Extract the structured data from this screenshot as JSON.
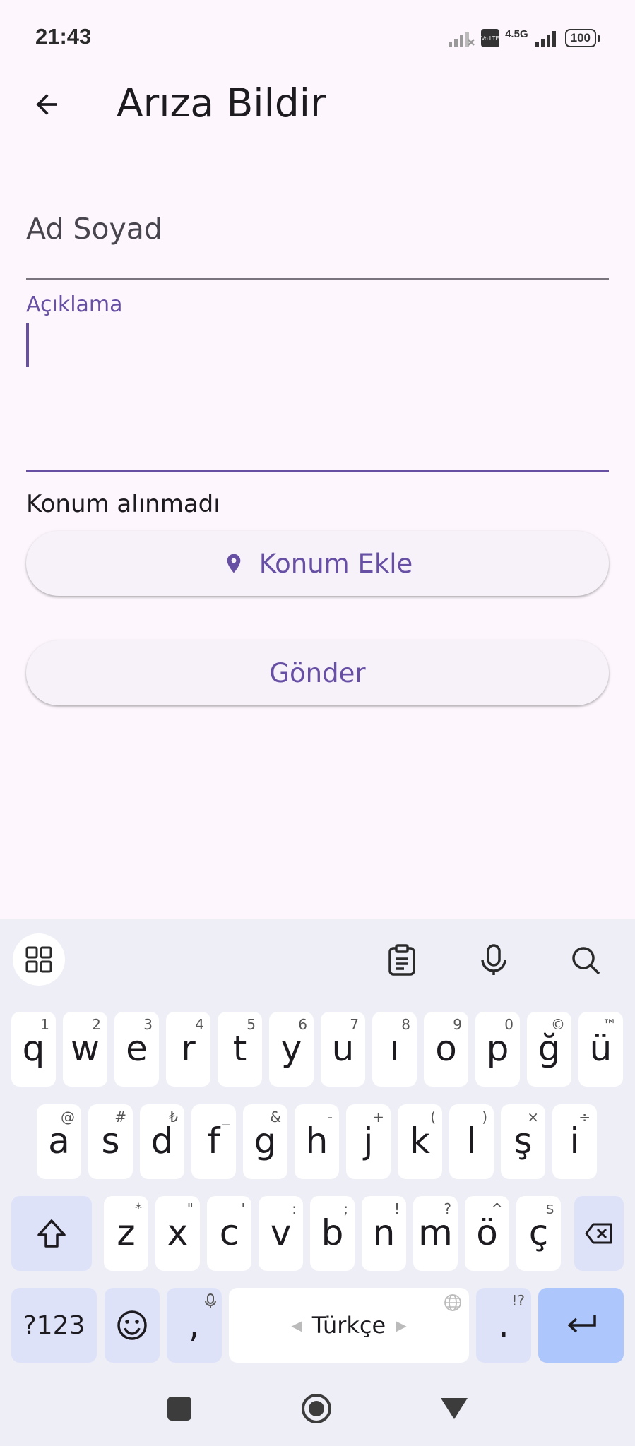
{
  "status_bar": {
    "time": "21:43",
    "network": "4.5G",
    "volte": "Vo LTE",
    "battery": "100"
  },
  "app_bar": {
    "back_icon": "arrow-back-icon",
    "title": "Arıza Bildir"
  },
  "form": {
    "name_placeholder": "Ad Soyad",
    "description_label": "Açıklama",
    "description_value": "",
    "location_status": "Konum alınmadı",
    "location_button_label": "Konum Ekle",
    "location_button_icon": "location-pin-icon",
    "submit_button_label": "Gönder"
  },
  "colors": {
    "primary": "#6750a4",
    "background": "#fdf7fd",
    "keyboard_background": "#eeeef7",
    "enter_key": "#adc6fc",
    "function_key": "#dde2f8"
  },
  "keyboard": {
    "toolbar": [
      "apps-grid-icon",
      "clipboard-icon",
      "microphone-icon",
      "search-icon"
    ],
    "row1": [
      {
        "key": "q",
        "hint": "1"
      },
      {
        "key": "w",
        "hint": "2"
      },
      {
        "key": "e",
        "hint": "3"
      },
      {
        "key": "r",
        "hint": "4"
      },
      {
        "key": "t",
        "hint": "5"
      },
      {
        "key": "y",
        "hint": "6"
      },
      {
        "key": "u",
        "hint": "7"
      },
      {
        "key": "ı",
        "hint": "8"
      },
      {
        "key": "o",
        "hint": "9"
      },
      {
        "key": "p",
        "hint": "0"
      },
      {
        "key": "ğ",
        "hint": "©"
      },
      {
        "key": "ü",
        "hint": "™"
      }
    ],
    "row2": [
      {
        "key": "a",
        "hint": "@"
      },
      {
        "key": "s",
        "hint": "#"
      },
      {
        "key": "d",
        "hint": "₺"
      },
      {
        "key": "f",
        "hint": "_"
      },
      {
        "key": "g",
        "hint": "&"
      },
      {
        "key": "h",
        "hint": "-"
      },
      {
        "key": "j",
        "hint": "+"
      },
      {
        "key": "k",
        "hint": "("
      },
      {
        "key": "l",
        "hint": ")"
      },
      {
        "key": "ş",
        "hint": "×"
      },
      {
        "key": "i",
        "hint": "÷"
      }
    ],
    "row3": [
      {
        "key": "z",
        "hint": "*"
      },
      {
        "key": "x",
        "hint": "\""
      },
      {
        "key": "c",
        "hint": "'"
      },
      {
        "key": "v",
        "hint": ":"
      },
      {
        "key": "b",
        "hint": ";"
      },
      {
        "key": "n",
        "hint": "!"
      },
      {
        "key": "m",
        "hint": "?"
      },
      {
        "key": "ö",
        "hint": "^"
      },
      {
        "key": "ç",
        "hint": "$"
      }
    ],
    "shift_icon": "shift-icon",
    "backspace_icon": "backspace-icon",
    "symbols_label": "?123",
    "emoji_icon": "emoji-icon",
    "comma_label": ",",
    "space_label": "Türkçe",
    "period_label": ".",
    "period_hint": "!?",
    "enter_icon": "enter-icon"
  },
  "nav_bar": [
    "recents-square-icon",
    "home-circle-icon",
    "back-triangle-icon"
  ]
}
